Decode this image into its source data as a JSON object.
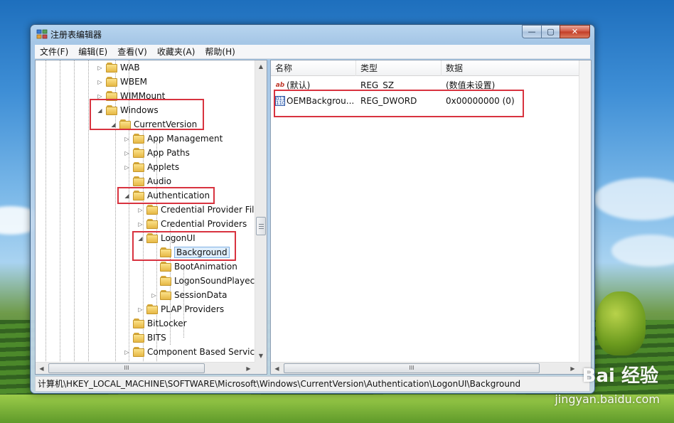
{
  "window": {
    "title": "注册表编辑器",
    "controls": {
      "minimize": "—",
      "maximize": "▢",
      "close": "✕"
    }
  },
  "menu": [
    "文件(F)",
    "编辑(E)",
    "查看(V)",
    "收藏夹(A)",
    "帮助(H)"
  ],
  "tree": {
    "items": [
      {
        "label": "WAB"
      },
      {
        "label": "WBEM"
      },
      {
        "label": "WIMMount"
      },
      {
        "label": "Windows"
      },
      {
        "label": "CurrentVersion"
      },
      {
        "label": "App Management"
      },
      {
        "label": "App Paths"
      },
      {
        "label": "Applets"
      },
      {
        "label": "Audio"
      },
      {
        "label": "Authentication"
      },
      {
        "label": "Credential Provider Fil"
      },
      {
        "label": "Credential Providers"
      },
      {
        "label": "LogonUI"
      },
      {
        "label": "Background"
      },
      {
        "label": "BootAnimation"
      },
      {
        "label": "LogonSoundPlayec"
      },
      {
        "label": "SessionData"
      },
      {
        "label": "PLAP Providers"
      },
      {
        "label": "BitLocker"
      },
      {
        "label": "BITS"
      },
      {
        "label": "Component Based Servic"
      }
    ],
    "scroll_h_label": "III"
  },
  "list": {
    "headers": {
      "name": "名称",
      "type": "类型",
      "data": "数据"
    },
    "rows": [
      {
        "icon": "ab",
        "name": "(默认)",
        "type": "REG_SZ",
        "data": "(数值未设置)"
      },
      {
        "icon": "011\n110",
        "name": "OEMBackgrou...",
        "type": "REG_DWORD",
        "data": "0x00000000 (0)"
      }
    ],
    "scroll_h_label": "III"
  },
  "status": "计算机\\HKEY_LOCAL_MACHINE\\SOFTWARE\\Microsoft\\Windows\\CurrentVersion\\Authentication\\LogonUI\\Background",
  "watermark": {
    "brand": "Bai  经验",
    "url": "jingyan.baidu.com"
  },
  "colors": {
    "highlight": "#d8333f",
    "selection": "#dfeefc"
  }
}
